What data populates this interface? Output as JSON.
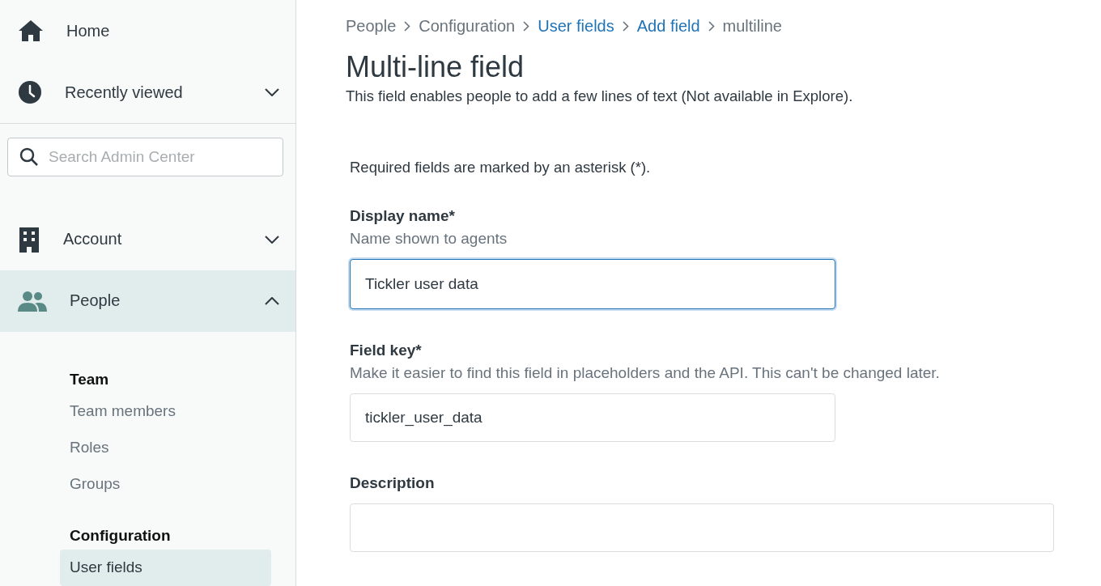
{
  "sidebar": {
    "nav_top": [
      {
        "label": "Home",
        "selected": false
      },
      {
        "label": "Recently viewed",
        "expanded": false,
        "selected": false
      }
    ],
    "search": {
      "placeholder": "Search Admin Center"
    },
    "nav": [
      {
        "label": "Account",
        "expanded": false,
        "selected": false
      },
      {
        "label": "People",
        "expanded": true,
        "selected": true
      }
    ],
    "sections": [
      {
        "heading": "Team",
        "items": [
          {
            "label": "Team members",
            "selected": false
          },
          {
            "label": "Roles",
            "selected": false
          },
          {
            "label": "Groups",
            "selected": false
          }
        ]
      },
      {
        "heading": "Configuration",
        "items": [
          {
            "label": "User fields",
            "selected": true
          }
        ]
      }
    ]
  },
  "breadcrumb": [
    {
      "label": "People",
      "link": false
    },
    {
      "label": "Configuration",
      "link": false
    },
    {
      "label": "User fields",
      "link": true
    },
    {
      "label": "Add field",
      "link": true
    },
    {
      "label": "multiline",
      "link": false
    }
  ],
  "title": "Multi-line field",
  "description": "This field enables people to add a few lines of text (Not available in Explore).",
  "required_note": "Required fields are marked by an asterisk (*).",
  "fields": [
    {
      "label": "Display name*",
      "hint": "Name shown to agents",
      "value": "Tickler user data",
      "focused": true,
      "kind": "input"
    },
    {
      "label": "Field key*",
      "hint": "Make it easier to find this field in placeholders and the API. This can't be changed later.",
      "value": "tickler_user_data",
      "focused": false,
      "kind": "input"
    },
    {
      "label": "Description",
      "focused": false,
      "kind": "textarea"
    }
  ]
}
